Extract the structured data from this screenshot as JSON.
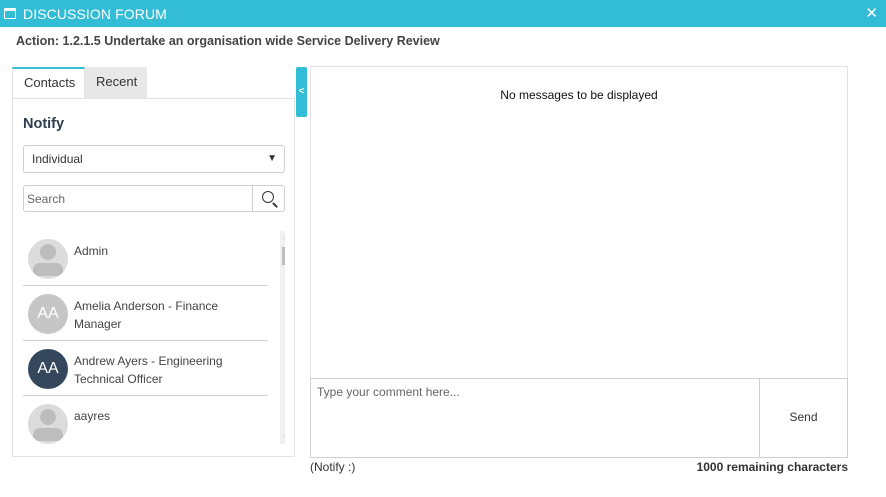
{
  "window": {
    "title": "DISCUSSION FORUM",
    "close_icon": "close-icon",
    "accent_color": "#33bcd5"
  },
  "action_title": "Action: 1.2.1.5 Undertake an organisation wide Service Delivery Review",
  "tabs": [
    {
      "label": "Contacts",
      "active": true
    },
    {
      "label": "Recent",
      "active": false
    }
  ],
  "notify": {
    "heading": "Notify",
    "mode_selected": "Individual",
    "search_placeholder": "Search"
  },
  "contacts": [
    {
      "name_line1": "Admin",
      "name_line2": "",
      "avatar": "generic"
    },
    {
      "name_line1": "Amelia Anderson - Finance",
      "name_line2": "Manager",
      "avatar": "initials",
      "initials": "AA",
      "avatar_color": "#c6c6c6"
    },
    {
      "name_line1": "Andrew Ayers - Engineering",
      "name_line2": "Technical Officer",
      "avatar": "initials",
      "initials": "AA",
      "avatar_color": "#34475c"
    },
    {
      "name_line1": "aayres",
      "name_line2": "",
      "avatar": "generic"
    }
  ],
  "messages": {
    "empty_text": "No messages to be displayed"
  },
  "composer": {
    "placeholder": "Type your comment here...",
    "send_label": "Send",
    "notify_status": "(Notify :)",
    "remaining": "1000 remaining characters"
  }
}
